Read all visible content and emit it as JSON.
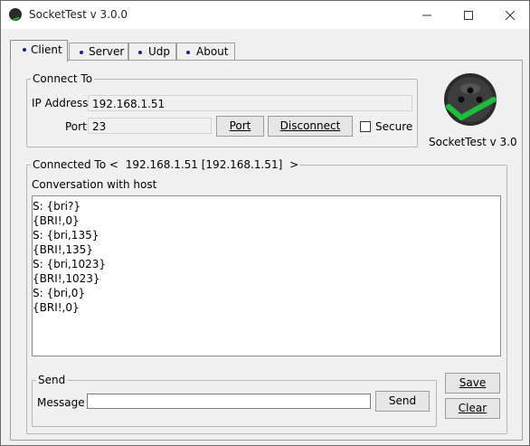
{
  "window": {
    "title": "SocketTest v 3.0.0"
  },
  "tabs": [
    {
      "label": "Client",
      "active": true
    },
    {
      "label": "Server",
      "active": false
    },
    {
      "label": "Udp",
      "active": false
    },
    {
      "label": "About",
      "active": false
    }
  ],
  "connect": {
    "legend": "Connect To",
    "ip_label": "IP Address",
    "ip_value": "192.168.1.51",
    "port_label": "Port",
    "port_value": "23",
    "port_button": "Port",
    "disconnect_button": "Disconnect",
    "secure_label": "Secure",
    "secure_checked": false
  },
  "logo": {
    "caption": "SocketTest v 3.0"
  },
  "connected": {
    "legend_prefix": "Connected To <",
    "legend_host": "192.168.1.51 [192.168.1.51]",
    "legend_suffix": ">",
    "conversation_label": "Conversation with host",
    "lines": [
      "S: {bri?}",
      "{BRI!,0}",
      "S: {bri,135}",
      "{BRI!,135}",
      "S: {bri,1023}",
      "{BRI!,1023}",
      "S: {bri,0}",
      "{BRI!,0}"
    ]
  },
  "send": {
    "legend": "Send",
    "message_label": "Message",
    "message_value": "",
    "send_button": "Send"
  },
  "actions": {
    "save_button": "Save",
    "clear_button": "Clear"
  },
  "colors": {
    "accent_dot": "#1a1aa8",
    "logo_check": "#1dbf3a"
  }
}
